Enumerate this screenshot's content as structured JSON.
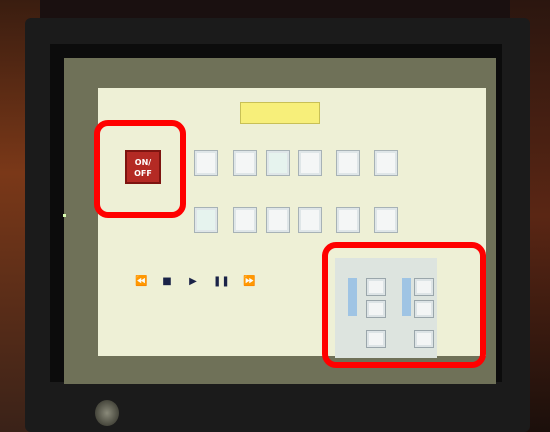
{
  "screen_title": "",
  "section_projector": "",
  "section_monitor": "",
  "section_player": "",
  "power": {
    "label": "ON/\nOFF",
    "caption": ""
  },
  "projector_buttons": [
    "",
    "",
    "",
    "",
    "",
    ""
  ],
  "monitor_buttons": [
    "",
    "",
    "",
    "",
    "",
    ""
  ],
  "player_controls": [
    "rewind-icon",
    "stop-icon",
    "play-icon",
    "pause-icon",
    "fast-forward-icon"
  ],
  "volume": {
    "left_level": 0.55,
    "right_level": 0.55
  },
  "highlight_color": "#ff0000",
  "power_color": "#b42a24"
}
